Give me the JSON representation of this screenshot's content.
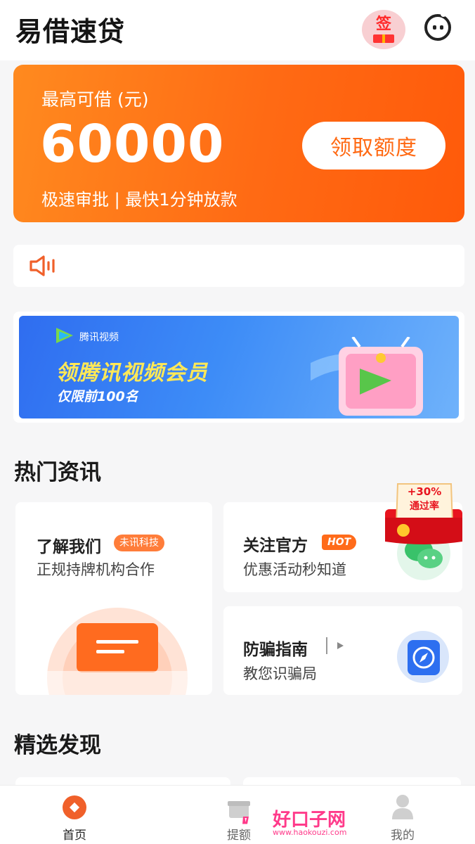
{
  "header": {
    "title": "易借速贷",
    "sign_label": "签"
  },
  "credit": {
    "label": "最高可借 (元)",
    "amount": "60000",
    "desc": "极速审批 | 最快1分钟放款",
    "button": "领取额度"
  },
  "banner": {
    "brand": "腾讯视频",
    "title": "领腾讯视频会员",
    "subtitle": "仅限前100名"
  },
  "news": {
    "section_title": "热门资讯",
    "about": {
      "title": "了解我们",
      "tag": "未讯科技",
      "subtitle": "正规持牌机构合作"
    },
    "official": {
      "title": "关注官方",
      "hot": "HOT",
      "subtitle": "优惠活动秒知道"
    },
    "promo": {
      "rate": "+30%",
      "label": "通过率"
    },
    "fraud": {
      "title": "防骗指南",
      "subtitle": "教您识骗局"
    }
  },
  "discover": {
    "section_title": "精选发现"
  },
  "tabbar": {
    "items": [
      {
        "label": "首页"
      },
      {
        "label": "提额"
      },
      {
        "label": "我的"
      }
    ]
  },
  "watermark": {
    "text": "好口子网",
    "url": "www.haokouzi.com"
  },
  "colors": {
    "accent": "#ff6a14",
    "banner_blue": "#3d8cf7"
  }
}
